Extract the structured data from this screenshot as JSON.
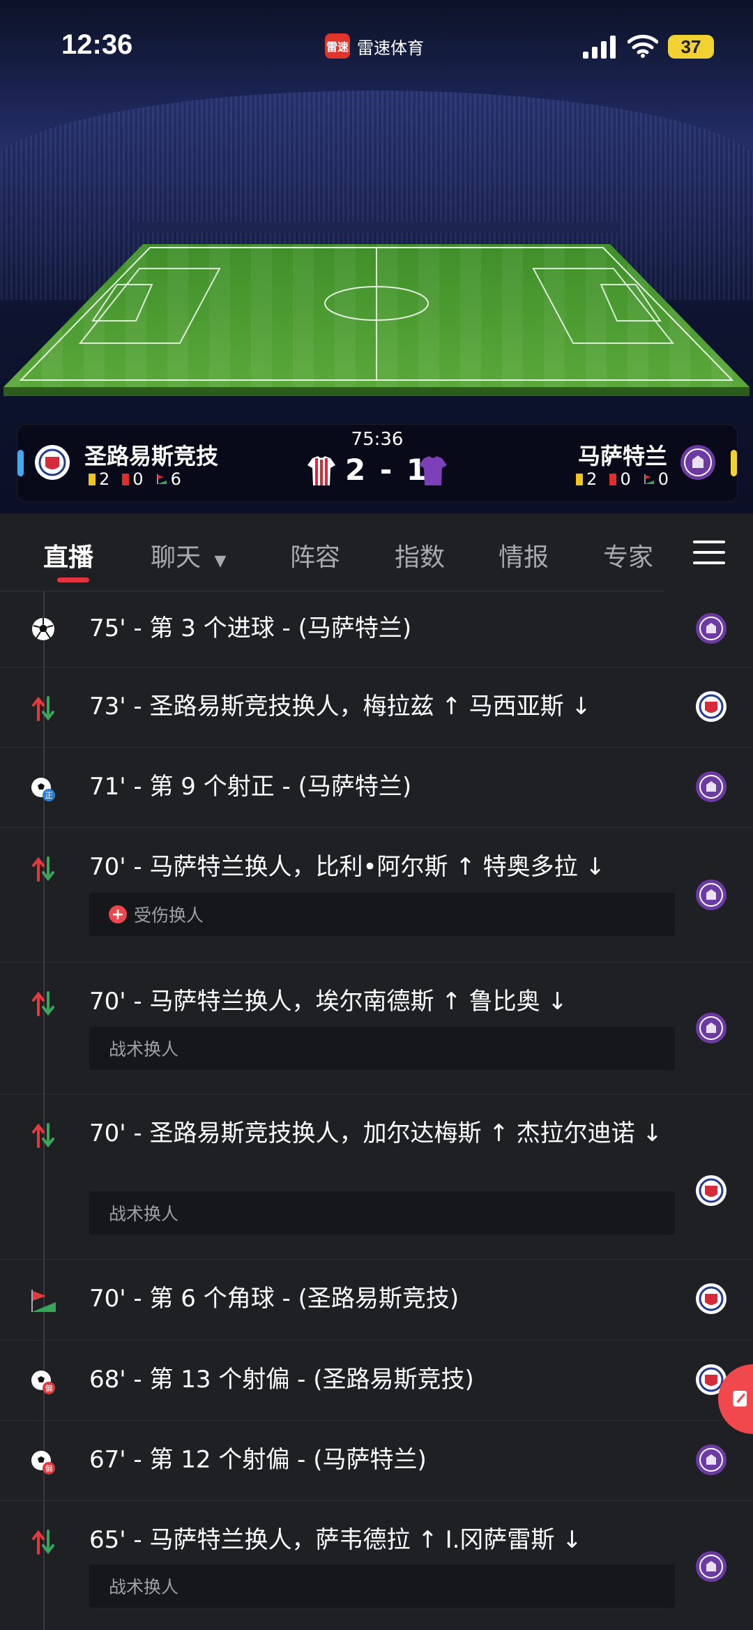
{
  "status_bar": {
    "time": "12:36",
    "app_name": "雷速体育",
    "app_logo_text": "雷速",
    "battery": "37"
  },
  "match": {
    "clock": "75:36",
    "home": {
      "name": "圣路易斯竞技",
      "yellow": "2",
      "red": "0",
      "corners": "6"
    },
    "away": {
      "name": "马萨特兰",
      "yellow": "2",
      "red": "0",
      "corners": "0"
    },
    "score_home": "2",
    "score_sep": "-",
    "score_away": "1"
  },
  "tabs": [
    {
      "label": "直播"
    },
    {
      "label": "聊天"
    },
    {
      "label": "阵容"
    },
    {
      "label": "指数"
    },
    {
      "label": "情报"
    },
    {
      "label": "专家"
    }
  ],
  "events": [
    {
      "text": "75' - 第 3 个进球 - (马萨特兰)",
      "icon": "goal-icon",
      "team": "away"
    },
    {
      "text": "73' - 圣路易斯竞技换人，梅拉兹 ↑ 马西亚斯 ↓",
      "icon": "substitution-icon",
      "team": "home"
    },
    {
      "text": "71' - 第 9 个射正 - (马萨特兰)",
      "icon": "shot-on-target-icon",
      "team": "away"
    },
    {
      "text": "70' - 马萨特兰换人，比利•阿尔斯 ↑ 特奥多拉 ↓",
      "icon": "substitution-icon",
      "team": "away",
      "note": "受伤换人"
    },
    {
      "text": "70' - 马萨特兰换人，埃尔南德斯 ↑ 鲁比奥 ↓",
      "icon": "substitution-icon",
      "team": "away",
      "note": "战术换人"
    },
    {
      "text": "70' - 圣路易斯竞技换人，加尔达梅斯 ↑ 杰拉尔迪诺 ↓",
      "icon": "substitution-icon",
      "team": "home",
      "note": "战术换人"
    },
    {
      "text": "70' - 第 6 个角球 - (圣路易斯竞技)",
      "icon": "corner-flag-icon",
      "team": "home"
    },
    {
      "text": "68' - 第 13 个射偏 - (圣路易斯竞技)",
      "icon": "shot-off-target-icon",
      "team": "home"
    },
    {
      "text": "67' - 第 12 个射偏 - (马萨特兰)",
      "icon": "shot-off-target-icon",
      "team": "away"
    },
    {
      "text": "65' - 马萨特兰换人，萨韦德拉 ↑ I.冈萨雷斯 ↓",
      "icon": "substitution-icon",
      "team": "away",
      "note": "战术换人"
    }
  ],
  "colors": {
    "accent": "#e3343f",
    "home_mark": "#3fa9f5",
    "away_mark": "#f2d232",
    "away_purple": "#7b3fb8"
  }
}
